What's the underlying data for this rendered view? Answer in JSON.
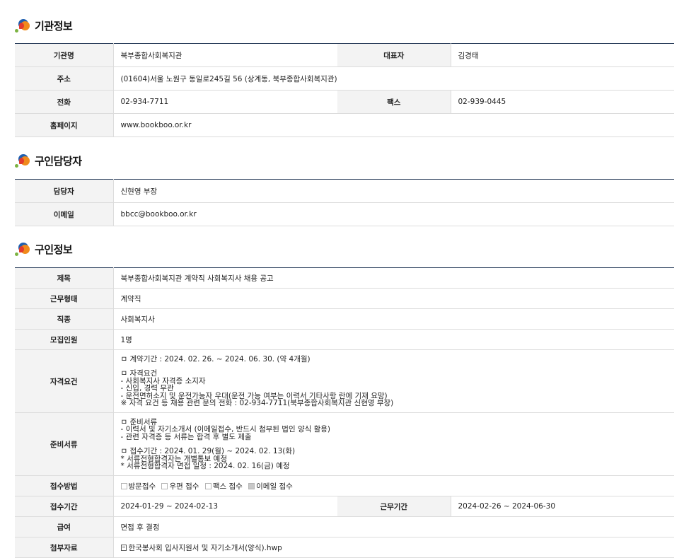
{
  "sections": {
    "org": {
      "title": "기관정보",
      "rows": {
        "name_label": "기관명",
        "name_value": "북부종합사회복지관",
        "rep_label": "대표자",
        "rep_value": "김경태",
        "addr_label": "주소",
        "addr_value": "(01604)서울 노원구 동일로245길 56 (상계동, 북부종합사회복지관)",
        "phone_label": "전화",
        "phone_value": "02-934-7711",
        "fax_label": "팩스",
        "fax_value": "02-939-0445",
        "home_label": "홈페이지",
        "home_value": "www.bookboo.or.kr"
      }
    },
    "contact": {
      "title": "구인담당자",
      "rows": {
        "person_label": "담당자",
        "person_value": "신현영 부장",
        "email_label": "이메일",
        "email_value": "bbcc@bookboo.or.kr"
      }
    },
    "job": {
      "title": "구인정보",
      "rows": {
        "title_label": "제목",
        "title_value": "북부종합사회복지관 계약직 사회복지사 채용 공고",
        "type_label": "근무형태",
        "type_value": "계약직",
        "occ_label": "직종",
        "occ_value": "사회복지사",
        "count_label": "모집인원",
        "count_value": "1명",
        "qual_label": "자격요건",
        "qual_lines": [
          "ㅁ 계약기간 : 2024. 02. 26. ~ 2024. 06. 30. (약 4개월)",
          "ㅁ 자격요건",
          "- 사회복지사 자격증 소지자",
          "- 신입, 경력 무관",
          "- 운전면허소지 및 운전가능자 우대(운전 가능 여부는 이력서 기타사항 란에 기재 요망)",
          "※ 자격 요건 등 채용 관련 문의 전화 : 02-934-7711(북부종합사회복지관 신현영 부장)"
        ],
        "docs_label": "준비서류",
        "docs_lines": [
          "ㅁ 준비서류",
          "- 이력서 및 자기소개서 (이메일접수, 반드시 첨부된 법인 양식 활용)",
          "- 관련 자격증 등 서류는 합격 후 별도 제출",
          "ㅁ 접수기간 : 2024. 01. 29(월) ~ 2024. 02. 13(화)",
          "* 서류전형합격자는 개별통보 예정",
          "* 서류전형합격자 면접 일정 : 2024. 02. 16(금) 예정"
        ],
        "method_label": "접수방법",
        "method_options": [
          "방문접수",
          "우편 접수",
          "팩스 접수",
          "이메일 접수"
        ],
        "period_label": "접수기간",
        "period_value": "2024-01-29 ~ 2024-02-13",
        "work_label": "근무기간",
        "work_value": "2024-02-26 ~ 2024-06-30",
        "pay_label": "급여",
        "pay_value": "면접 후 결정",
        "attach_label": "첨부자료",
        "attach_value": "한국봉사회 입사지원서 및 자기소개서(양식).hwp"
      }
    }
  }
}
